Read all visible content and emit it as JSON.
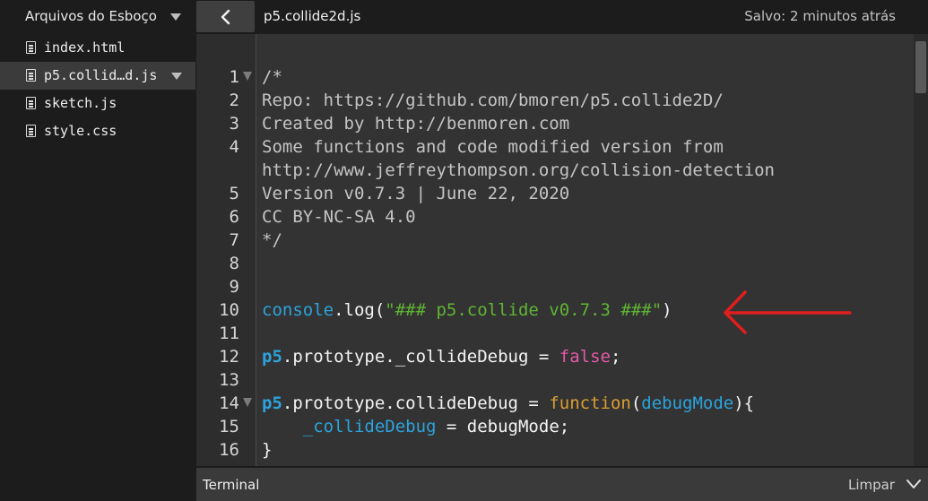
{
  "sidebar": {
    "title": "Arquivos do Esboço",
    "files": [
      {
        "label": "index.html"
      },
      {
        "label": "p5.collid…d.js"
      },
      {
        "label": "sketch.js"
      },
      {
        "label": "style.css"
      }
    ]
  },
  "header": {
    "file_name": "p5.collide2d.js",
    "saved_status": "Salvo: 2 minutos atrás"
  },
  "editor": {
    "line_numbers": [
      "1",
      "2",
      "3",
      "4",
      "",
      "5",
      "6",
      "7",
      "8",
      "9",
      "10",
      "11",
      "12",
      "13",
      "14",
      "15",
      "16"
    ],
    "lines": {
      "l1": "/*",
      "l2": "Repo: https://github.com/bmoren/p5.collide2D/",
      "l3": "Created by http://benmoren.com",
      "l4": "Some functions and code modified version from",
      "l4b": "http://www.jeffreythompson.org/collision-detection",
      "l5": "Version v0.7.3 | June 22, 2020",
      "l6": "CC BY-NC-SA 4.0",
      "l7": "*/",
      "l10_obj": "console",
      "l10_dot": ".log(",
      "l10_str": "\"### p5.collide v0.7.3 ###\"",
      "l10_end": ")",
      "l12_obj": "p5",
      "l12_rest": ".prototype._collideDebug = ",
      "l12_bool": "false",
      "l12_end": ";",
      "l14_obj": "p5",
      "l14_rest": ".prototype.collideDebug = ",
      "l14_func": "function",
      "l14_open": "(",
      "l14_param": "debugMode",
      "l14_close": "){",
      "l15_indent": "    ",
      "l15_var": "_collideDebug",
      "l15_rest": " = debugMode;",
      "l16": "}"
    }
  },
  "terminal": {
    "label": "Terminal",
    "clear_label": "Limpar"
  },
  "colors": {
    "annotation_arrow": "#e01e1e",
    "string": "#5fb434",
    "keyword_object": "#2ca3dc",
    "boolean": "#e35aa8",
    "function_keyword": "#d99e32"
  }
}
